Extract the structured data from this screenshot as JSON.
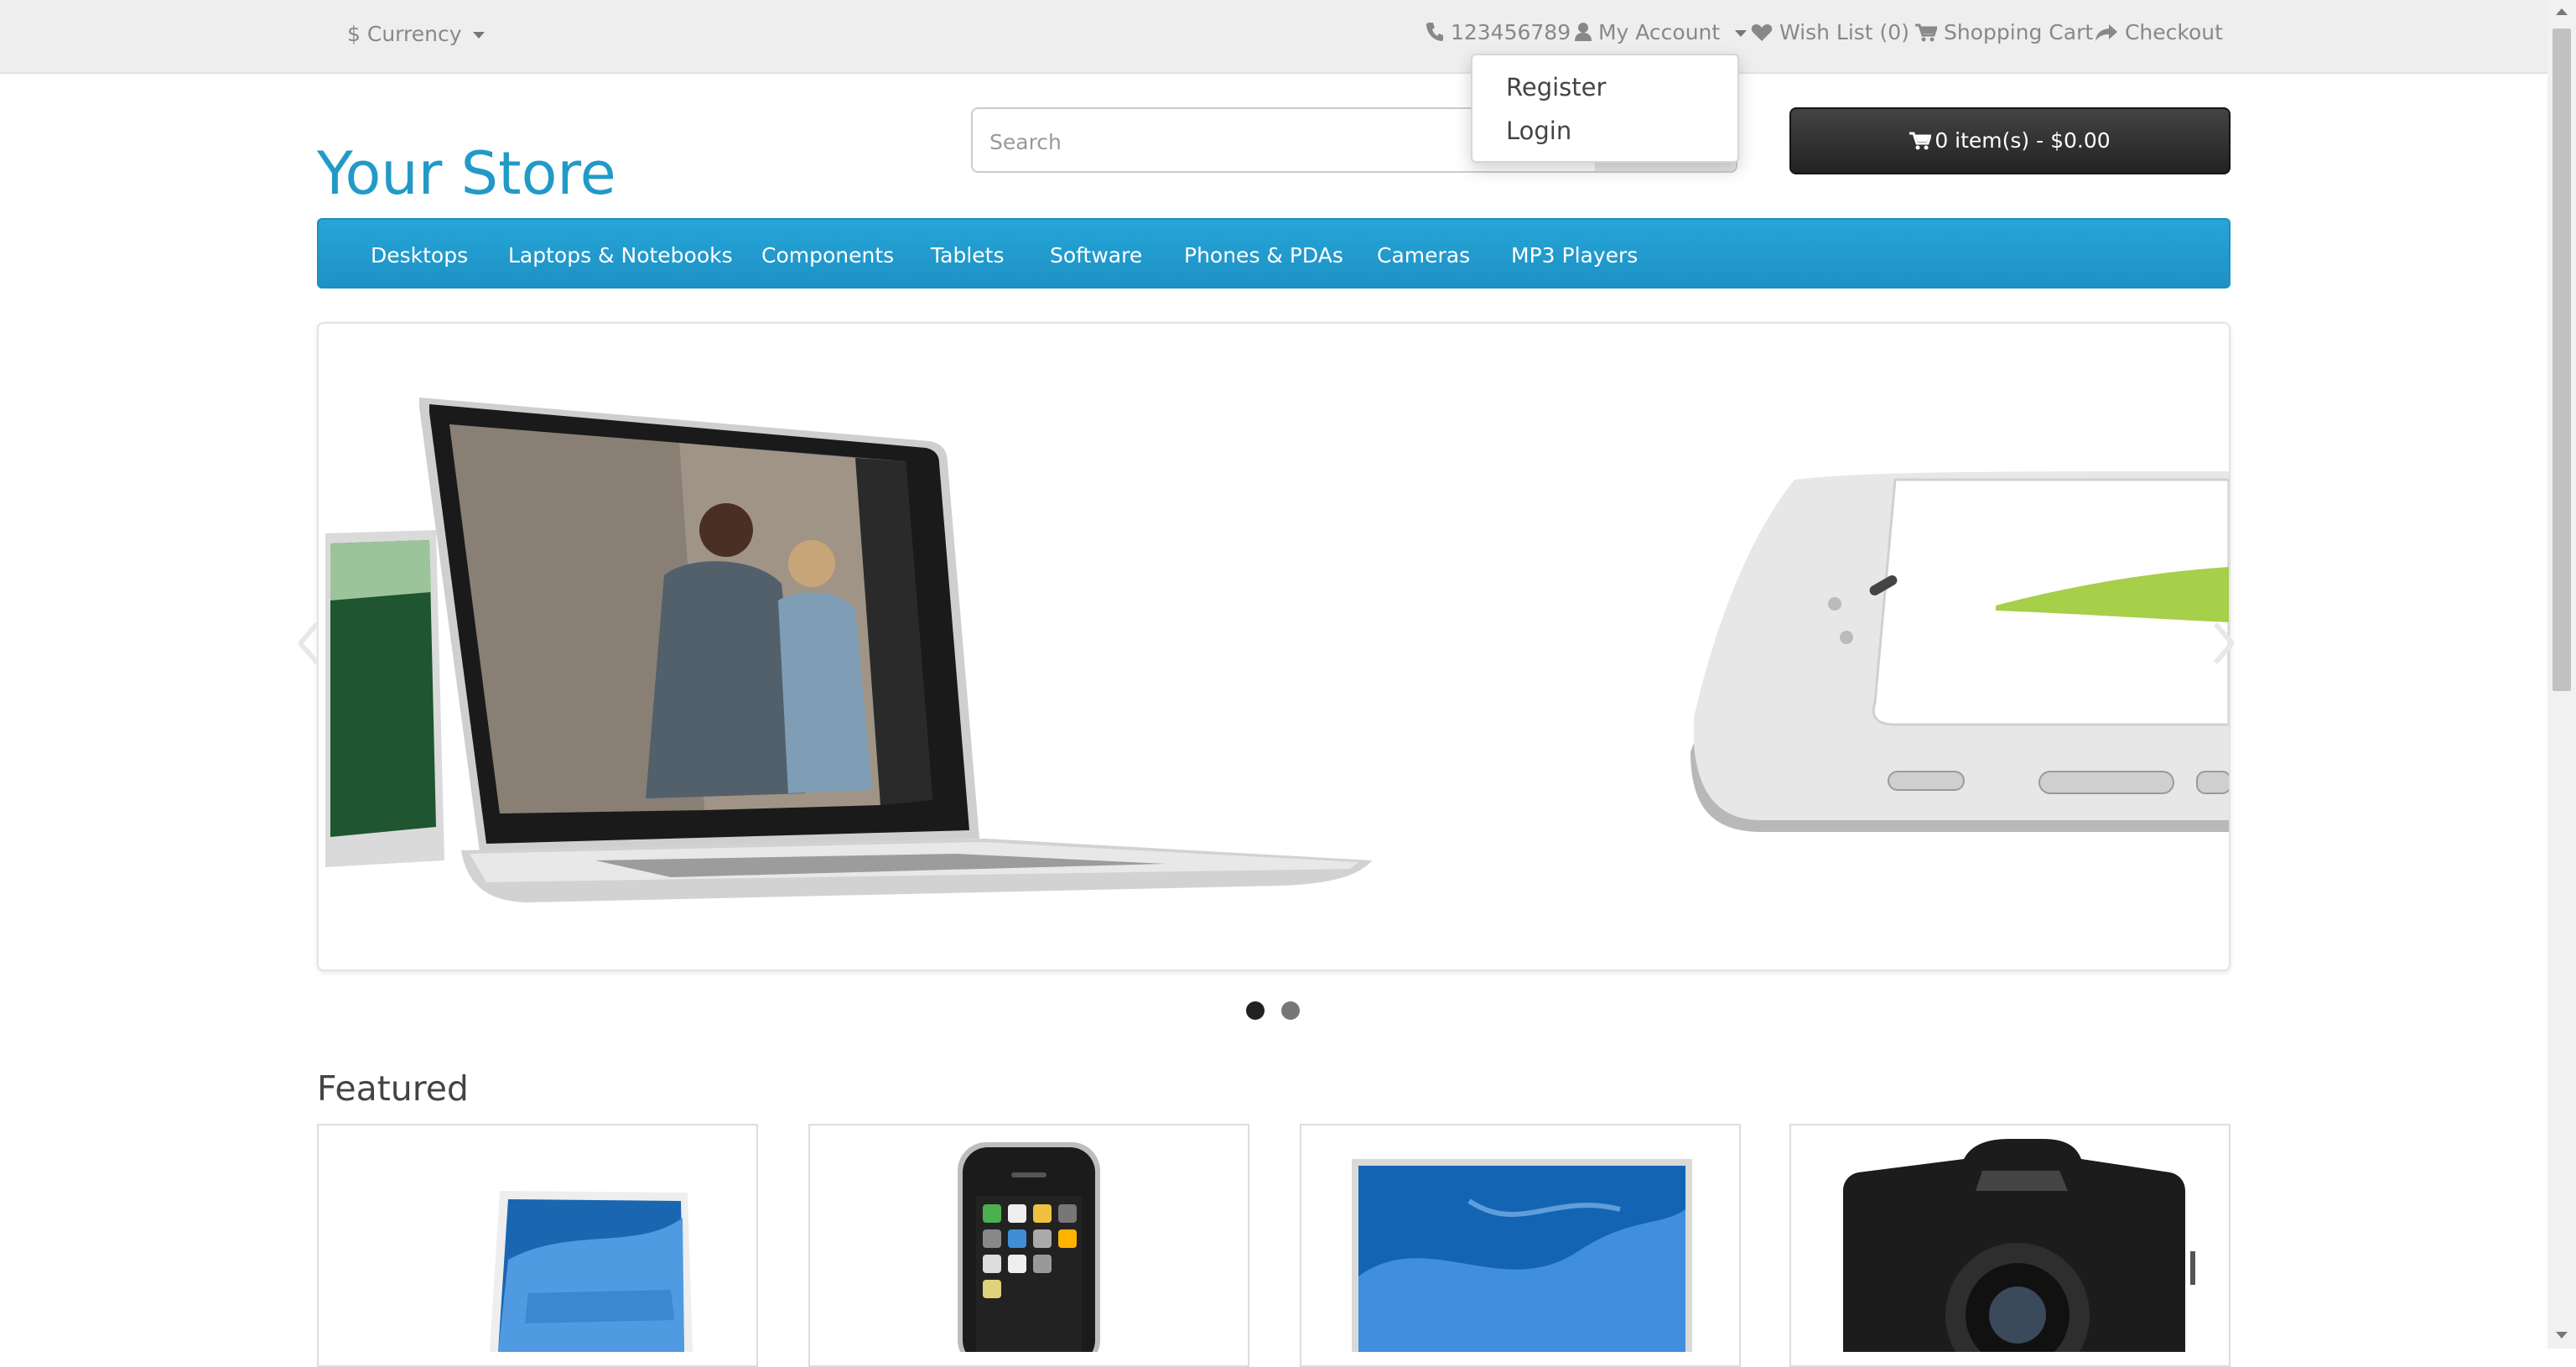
{
  "topbar": {
    "currency_label": "Currency",
    "currency_symbol": "$",
    "phone": "123456789",
    "my_account": "My Account",
    "wishlist": "Wish List (0)",
    "shopping_cart": "Shopping Cart",
    "checkout": "Checkout"
  },
  "account_dropdown": {
    "items": [
      "Register",
      "Login"
    ]
  },
  "header": {
    "logo": "Your Store",
    "search_placeholder": "Search",
    "cart_summary": "0 item(s) - $0.00"
  },
  "menu": {
    "items": [
      "Desktops",
      "Laptops & Notebooks",
      "Components",
      "Tablets",
      "Software",
      "Phones & PDAs",
      "Cameras",
      "MP3 Players"
    ]
  },
  "slideshow": {
    "active_index": 0,
    "slide_count": 2
  },
  "featured": {
    "title": "Featured",
    "products": [
      {
        "image": "macbook-image"
      },
      {
        "image": "iphone-image"
      },
      {
        "image": "apple-cinema-display-image"
      },
      {
        "image": "canon-camera-image"
      }
    ]
  },
  "colors": {
    "brand": "#229ac8",
    "menu": "#229ac8",
    "cart_button": "#303030",
    "topbar": "#eeeeee"
  }
}
